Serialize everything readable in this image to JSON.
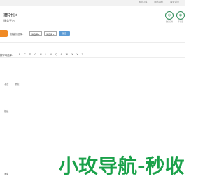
{
  "topbar": {
    "links": [
      "网站订单",
      "网站导航",
      "最近浏览"
    ]
  },
  "header": {
    "title": "商社区",
    "subtitle": "服务平台"
  },
  "header_icons": [
    {
      "name": "app-icon",
      "glyph": "◎",
      "label": "微信应用"
    },
    {
      "name": "mobile-icon",
      "glyph": "◉",
      "label": "手机版"
    }
  ],
  "toolbar": {
    "filter_label": "按省份选择：",
    "province_select": "请选择 ▾",
    "city_select": "请选择 ▾",
    "go_label": "确定"
  },
  "letter_filter": {
    "label": "按字母选择：",
    "letters": [
      "B",
      "C",
      "D",
      "G",
      "H",
      "L",
      "N",
      "Q",
      "S",
      "W",
      "X",
      "Y",
      "Z"
    ]
  },
  "tags": {
    "t1": "北京",
    "t2": "重庆",
    "t3": "福建",
    "t4": "海南"
  },
  "watermark": "小玫导航-秒收"
}
